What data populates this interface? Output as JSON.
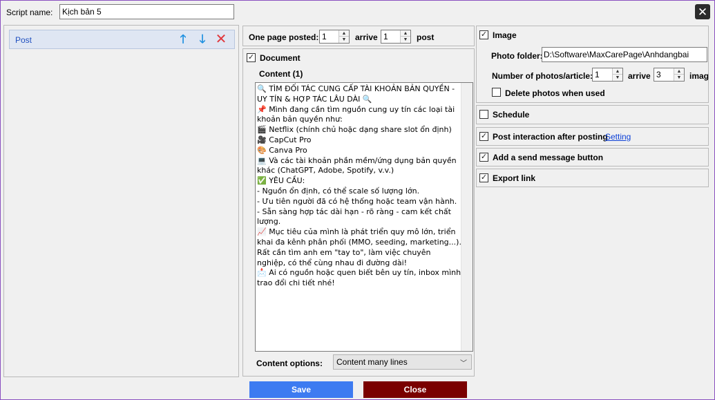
{
  "header": {
    "script_name_label": "Script name:",
    "script_name_value": "Kịch bản 5"
  },
  "post_list": {
    "items": [
      {
        "label": "Post"
      }
    ]
  },
  "posting": {
    "one_page_posted_label": "One page posted:",
    "from_value": "1",
    "arrive_label": "arrive",
    "to_value": "1",
    "post_label": "post"
  },
  "document": {
    "checked": true,
    "label": "Document",
    "content_label": "Content (1)",
    "content_text": "🔍 TÌM ĐỐI TÁC CUNG CẤP TÀI KHOẢN BẢN QUYỀN - UY TÍN & HỢP TÁC LÂU DÀI 🔍\n📌 Mình đang cần tìm nguồn cung uy tín các loại tài khoản bản quyền như:\n🎬 Netflix (chính chủ hoặc dạng share slot ổn định)\n🎥 CapCut Pro\n🎨 Canva Pro\n💻 Và các tài khoản phần mềm/ứng dụng bản quyền khác (ChatGPT, Adobe, Spotify, v.v.)\n✅ YÊU CẦU:\n- Nguồn ổn định, có thể scale số lượng lớn.\n- Ưu tiên người đã có hệ thống hoặc team vận hành.\n- Sẵn sàng hợp tác dài hạn - rõ ràng - cam kết chất lượng.\n📈 Mục tiêu của mình là phát triển quy mô lớn, triển khai đa kênh phân phối (MMO, seeding, marketing...). Rất cần tìm anh em \"tay to\", làm việc chuyên nghiệp, có thể cùng nhau đi đường dài!\n📩 Ai có nguồn hoặc quen biết bên uy tín, inbox mình trao đổi chi tiết nhé!",
    "content_options_label": "Content options:",
    "content_options_value": "Content many lines"
  },
  "image": {
    "checked": true,
    "label": "Image",
    "photo_folder_label": "Photo folder:",
    "photo_folder_value": "D:\\Software\\MaxCarePage\\Anhdangbai",
    "number_label": "Number of photos/article:",
    "from_value": "1",
    "arrive_label": "arrive",
    "to_value": "3",
    "suffix_label": "imag",
    "delete_label": "Delete photos when used",
    "delete_checked": false
  },
  "schedule": {
    "checked": false,
    "label": "Schedule"
  },
  "interaction": {
    "checked": true,
    "label": "Post interaction after posting",
    "setting_link": "Setting"
  },
  "send_message": {
    "checked": true,
    "label": "Add a send message button"
  },
  "export_link": {
    "checked": true,
    "label": "Export link"
  },
  "footer": {
    "save_label": "Save",
    "close_label": "Close"
  },
  "icons": {
    "close": "close-icon",
    "up": "arrow-up-icon",
    "down": "arrow-down-icon",
    "remove": "remove-icon",
    "check_mark": "✓"
  },
  "colors": {
    "save_button": "#3d7bf1",
    "close_button": "#7a0000",
    "post_item_bg": "#dfe6f3",
    "post_label": "#1f4fbf",
    "up_down_arrows": "#1c8fe0",
    "remove_x": "#e0373c",
    "link": "#0b3fd6"
  }
}
